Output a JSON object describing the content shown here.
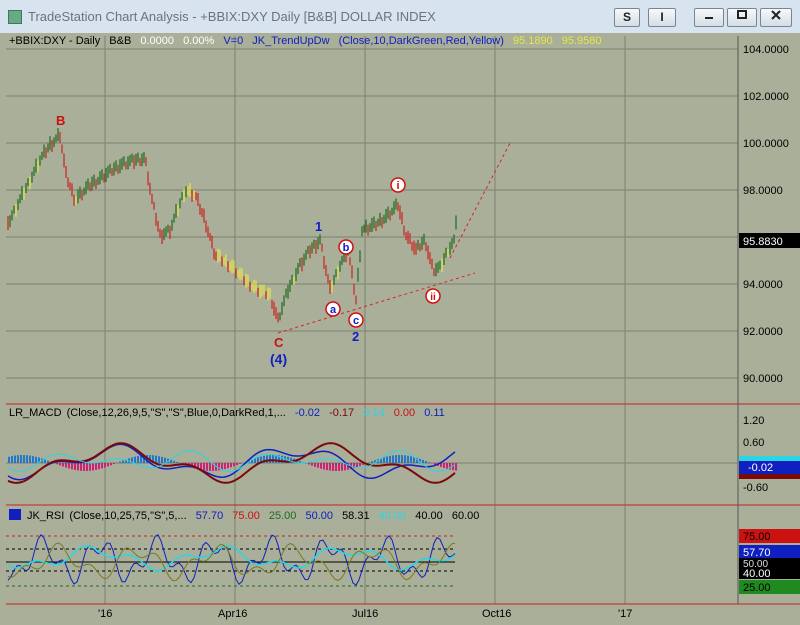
{
  "window": {
    "title": "TradeStation Chart Analysis - +BBIX:DXY Daily [B&B] DOLLAR INDEX",
    "buttons": {
      "s": "S",
      "i": "I"
    }
  },
  "price_panel": {
    "symbol_label": "+BBIX:DXY - Daily",
    "bb_label": "B&B",
    "change": "0.0000",
    "change_pct": "0.00%",
    "volume": "V=0",
    "indicator": "JK_TrendUpDw",
    "indicator_params": "(Close,10,DarkGreen,Red,Yellow)",
    "val1": "95.1890",
    "val2": "95.9580",
    "last_price": "95.8830",
    "y_ticks": [
      "104.0000",
      "102.0000",
      "100.0000",
      "98.0000",
      "94.0000",
      "92.0000",
      "90.0000"
    ],
    "wave_labels": {
      "B": "B",
      "C": "C",
      "four": "(4)",
      "one": "1",
      "two": "2",
      "a": "a",
      "b": "b",
      "c": "c",
      "i": "i",
      "ii": "ii"
    }
  },
  "macd_panel": {
    "label": "LR_MACD",
    "params": "(Close,12,26,9,5,\"S\",\"S\",Blue,0,DarkRed,1,...",
    "v1": "-0.02",
    "v2": "-0.17",
    "v3": "0.14",
    "v4": "0.00",
    "v5": "0.11",
    "y_ticks": [
      "1.20",
      "0.60",
      "-0.60"
    ],
    "badge_values": [
      "-0.02"
    ]
  },
  "rsi_panel": {
    "label": "JK_RSI",
    "params": "(Close,10,25,75,\"S\",5,...",
    "v1": "57.70",
    "v2": "75.00",
    "v3": "25.00",
    "v4": "50.00",
    "v5": "58.31",
    "v6": "40.00",
    "v7": "40.00",
    "v8": "60.00",
    "badges": [
      "75.00",
      "57.70",
      "50.00",
      "40.00",
      "25.00"
    ]
  },
  "x_axis": {
    "labels": [
      "'16",
      "Apr16",
      "Jul16",
      "Oct16",
      "'17"
    ]
  },
  "colors": {
    "background": "#a9af98",
    "up_bar": "#1f6b1f",
    "down_bar": "#cc2222",
    "neutral_bar": "#e6e64a",
    "wave_blue": "#1020c0",
    "wave_red": "#cc1111"
  }
}
